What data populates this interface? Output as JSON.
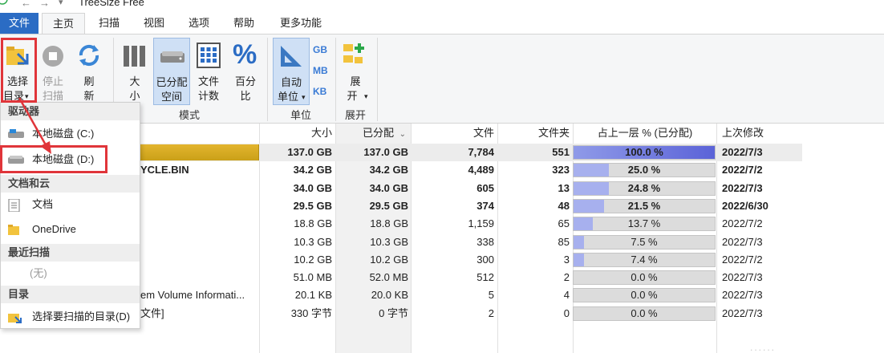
{
  "titlebar": {
    "title": "TreeSize Free",
    "back": "←",
    "forward": "→",
    "qa_arrow": "▾"
  },
  "tabs": [
    "文件",
    "主页",
    "扫描",
    "视图",
    "选项",
    "帮助",
    "更多功能"
  ],
  "ribbon": {
    "select_dir": {
      "line1": "选择",
      "line2": "目录",
      "arrow": "▾"
    },
    "stop_scan": {
      "line1": "停止",
      "line2": "扫描"
    },
    "refresh": {
      "line1": "刷",
      "line2": "新"
    },
    "size": {
      "line1": "大",
      "line2": "小"
    },
    "allocated": {
      "line1": "已分配",
      "line2": "空间"
    },
    "file_count": {
      "line1": "文件",
      "line2": "计数"
    },
    "percent": {
      "line1": "百分",
      "line2": "比"
    },
    "auto_unit": {
      "line1": "自动",
      "line2": "单位",
      "arrow": "▾"
    },
    "unit_gb": "GB",
    "unit_mb": "MB",
    "unit_kb": "KB",
    "expand": {
      "line1": "展",
      "line2": "开",
      "arrow": "▾"
    },
    "group_mode": "模式",
    "group_unit": "单位",
    "group_expand": "展开"
  },
  "menu": {
    "drives_header": "驱动器",
    "drive_c": "本地磁盘 (C:)",
    "drive_d": "本地磁盘 (D:)",
    "docs_header": "文档和云",
    "documents": "文档",
    "onedrive": "OneDrive",
    "recent_header": "最近扫描",
    "recent_none": "(无)",
    "dir_header": "目录",
    "choose_dir": "选择要扫描的目录(D)"
  },
  "table": {
    "headers": {
      "size": "大小",
      "allocated": "已分配",
      "files": "文件",
      "folders": "文件夹",
      "percent": "占上一层 % (已分配)",
      "modified": "上次修改"
    },
    "rows": [
      {
        "name": "",
        "size": "137.0 GB",
        "alloc": "137.0 GB",
        "files": "7,784",
        "folders": "551",
        "pct": "100.0 %",
        "pct_value": 100.0,
        "date": "2022/7/3",
        "bold": true
      },
      {
        "name": "YCLE.BIN",
        "size": "34.2 GB",
        "alloc": "34.2 GB",
        "files": "4,489",
        "folders": "323",
        "pct": "25.0 %",
        "pct_value": 25.0,
        "date": "2022/7/2",
        "bold": true
      },
      {
        "name": "",
        "size": "34.0 GB",
        "alloc": "34.0 GB",
        "files": "605",
        "folders": "13",
        "pct": "24.8 %",
        "pct_value": 24.8,
        "date": "2022/7/3",
        "bold": true
      },
      {
        "name": "",
        "size": "29.5 GB",
        "alloc": "29.5 GB",
        "files": "374",
        "folders": "48",
        "pct": "21.5 %",
        "pct_value": 21.5,
        "date": "2022/6/30",
        "bold": true
      },
      {
        "name": "",
        "size": "18.8 GB",
        "alloc": "18.8 GB",
        "files": "1,159",
        "folders": "65",
        "pct": "13.7 %",
        "pct_value": 13.7,
        "date": "2022/7/2",
        "bold": false
      },
      {
        "name": "",
        "size": "10.3 GB",
        "alloc": "10.3 GB",
        "files": "338",
        "folders": "85",
        "pct": "7.5 %",
        "pct_value": 7.5,
        "date": "2022/7/3",
        "bold": false
      },
      {
        "name": "",
        "size": "10.2 GB",
        "alloc": "10.2 GB",
        "files": "300",
        "folders": "3",
        "pct": "7.4 %",
        "pct_value": 7.4,
        "date": "2022/7/2",
        "bold": false
      },
      {
        "name": "",
        "size": "51.0 MB",
        "alloc": "52.0 MB",
        "files": "512",
        "folders": "2",
        "pct": "0.0 %",
        "pct_value": 0.0,
        "date": "2022/7/3",
        "bold": false
      },
      {
        "name": "em Volume Informati...",
        "size": "20.1 KB",
        "alloc": "20.0 KB",
        "files": "5",
        "folders": "4",
        "pct": "0.0 %",
        "pct_value": 0.0,
        "date": "2022/7/3",
        "bold": false
      },
      {
        "name": "文件]",
        "size": "330 字节",
        "alloc": "0 字节",
        "files": "2",
        "folders": "0",
        "pct": "0.0 %",
        "pct_value": 0.0,
        "date": "2022/7/3",
        "bold": false
      }
    ]
  },
  "watermark": "......",
  "colors": {
    "accent": "#2b6cc4",
    "bar": "#a7b0ee",
    "highlight": "#e0353a",
    "root_bar": "#d6aa1f"
  }
}
